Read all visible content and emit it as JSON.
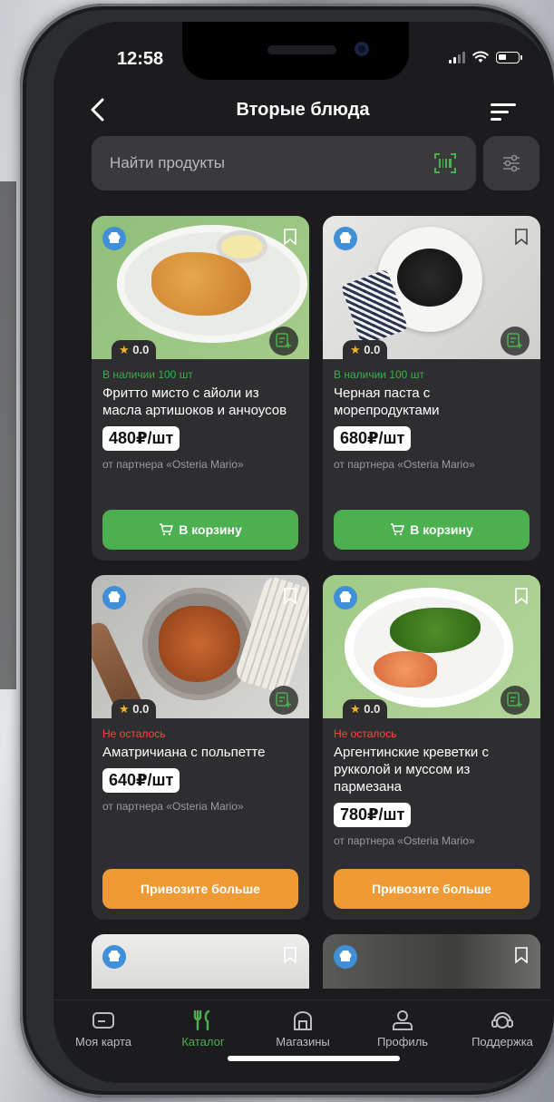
{
  "status": {
    "time": "12:58"
  },
  "header": {
    "title": "Вторые блюда"
  },
  "search": {
    "placeholder": "Найти продукты"
  },
  "products": [
    {
      "stock": "В наличии 100 шт",
      "stock_status": "available",
      "name": "Фритто мисто с айоли из масла артишоков и анчоусов",
      "price": "480₽/шт",
      "rating": "0.0",
      "partner": "от партнера «Osteria Mario»",
      "button": "В корзину",
      "button_color": "#4caf50"
    },
    {
      "stock": "В наличии 100 шт",
      "stock_status": "available",
      "name": "Черная паста с морепродуктами",
      "price": "680₽/шт",
      "rating": "0.0",
      "partner": "от партнера «Osteria Mario»",
      "button": "В корзину",
      "button_color": "#4caf50"
    },
    {
      "stock": "Не осталось",
      "stock_status": "out",
      "name": "Аматричиана с польпетте",
      "price": "640₽/шт",
      "rating": "0.0",
      "partner": "от партнера «Osteria Mario»",
      "button": "Привозите больше",
      "button_color": "#f09a35"
    },
    {
      "stock": "Не осталось",
      "stock_status": "out",
      "name": "Аргентинские креветки с рукколой и муссом из пармезана",
      "price": "780₽/шт",
      "rating": "0.0",
      "partner": "от партнера «Osteria Mario»",
      "button": "Привозите больше",
      "button_color": "#f09a35"
    }
  ],
  "tabbar": {
    "items": [
      {
        "label": "Моя карта",
        "icon": "card-icon"
      },
      {
        "label": "Каталог",
        "icon": "fork-knife-icon",
        "active": true
      },
      {
        "label": "Магазины",
        "icon": "store-icon"
      },
      {
        "label": "Профиль",
        "icon": "profile-icon"
      },
      {
        "label": "Поддержка",
        "icon": "support-icon"
      }
    ]
  },
  "colors": {
    "accent": "#4caf50",
    "warning": "#f09a35",
    "available": "#3cae4c",
    "out": "#ff453a",
    "badge": "#3f8fd9"
  }
}
